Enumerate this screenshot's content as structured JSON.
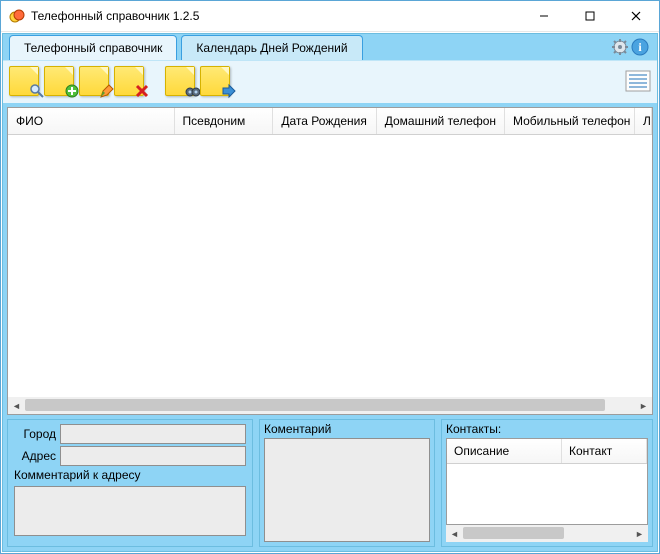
{
  "title": "Телефонный справочник 1.2.5",
  "tabs": [
    {
      "label": "Телефонный справочник",
      "active": true
    },
    {
      "label": "Календарь Дней Рождений",
      "active": false
    }
  ],
  "toolbar_icons": {
    "search": "search-note-icon",
    "add": "add-note-icon",
    "edit": "edit-note-icon",
    "delete": "delete-note-icon",
    "find": "find-note-icon",
    "export": "export-note-icon",
    "list_view": "list-view-icon"
  },
  "header_icons": {
    "settings": "gear-icon",
    "info": "info-icon"
  },
  "grid": {
    "columns": [
      "ФИО",
      "Псевдоним",
      "Дата Рождения",
      "Домашний телефон",
      "Мобильный телефон",
      "Л"
    ],
    "rows": []
  },
  "form": {
    "city_label": "Город",
    "city_value": "",
    "address_label": "Адрес",
    "address_value": "",
    "addr_comment_label": "Комментарий к адресу",
    "addr_comment_value": "",
    "comment_label": "Коментарий",
    "comment_value": ""
  },
  "contacts": {
    "title": "Контакты:",
    "columns": [
      "Описание",
      "Контакт"
    ],
    "rows": []
  }
}
